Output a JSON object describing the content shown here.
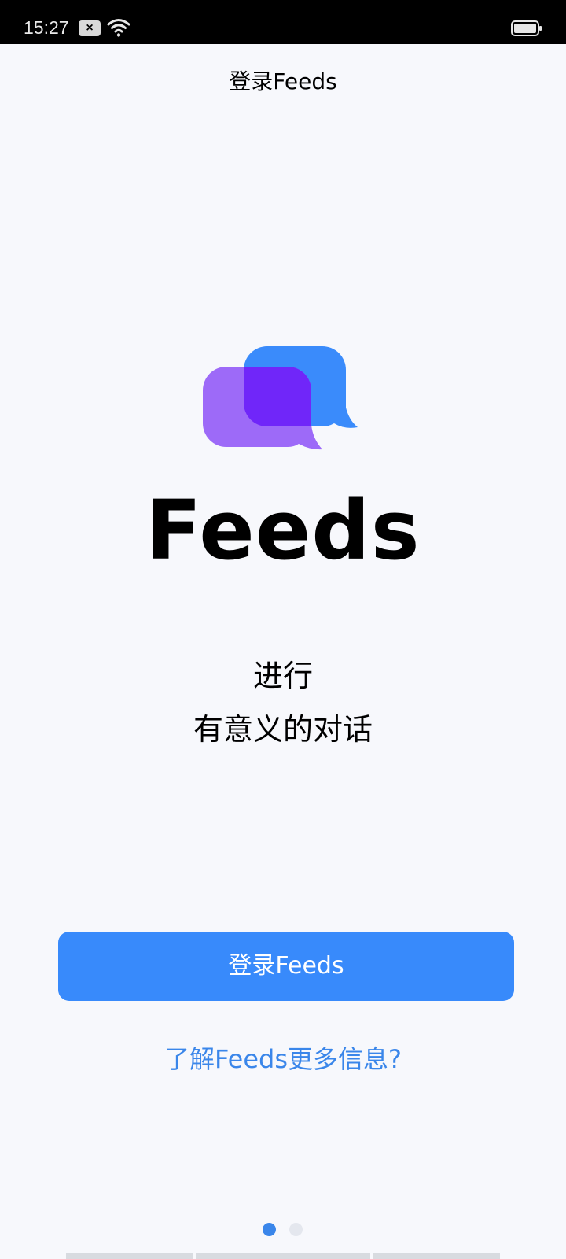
{
  "status_bar": {
    "time": "15:27",
    "notification_icon": "close-box-icon",
    "wifi_icon": "wifi-icon",
    "battery_icon": "battery-icon",
    "background": "#000000"
  },
  "header": {
    "title": "登录Feeds"
  },
  "brand": {
    "logo_icon": "chat-bubbles-icon",
    "name": "Feeds",
    "colors": {
      "blue_bubble": "#3A8BFB",
      "purple_bubble": "#9D6AF8",
      "overlap": "#7026F9"
    }
  },
  "tagline": {
    "line1": "进行",
    "line2": "有意义的对话"
  },
  "actions": {
    "login_label": "登录Feeds",
    "learn_more_label": "了解Feeds更多信息?"
  },
  "pager": {
    "total": 2,
    "current": 1
  },
  "colors": {
    "accent": "#388AFB",
    "link": "#3A86EA",
    "page_background": "#F7F8FC"
  }
}
